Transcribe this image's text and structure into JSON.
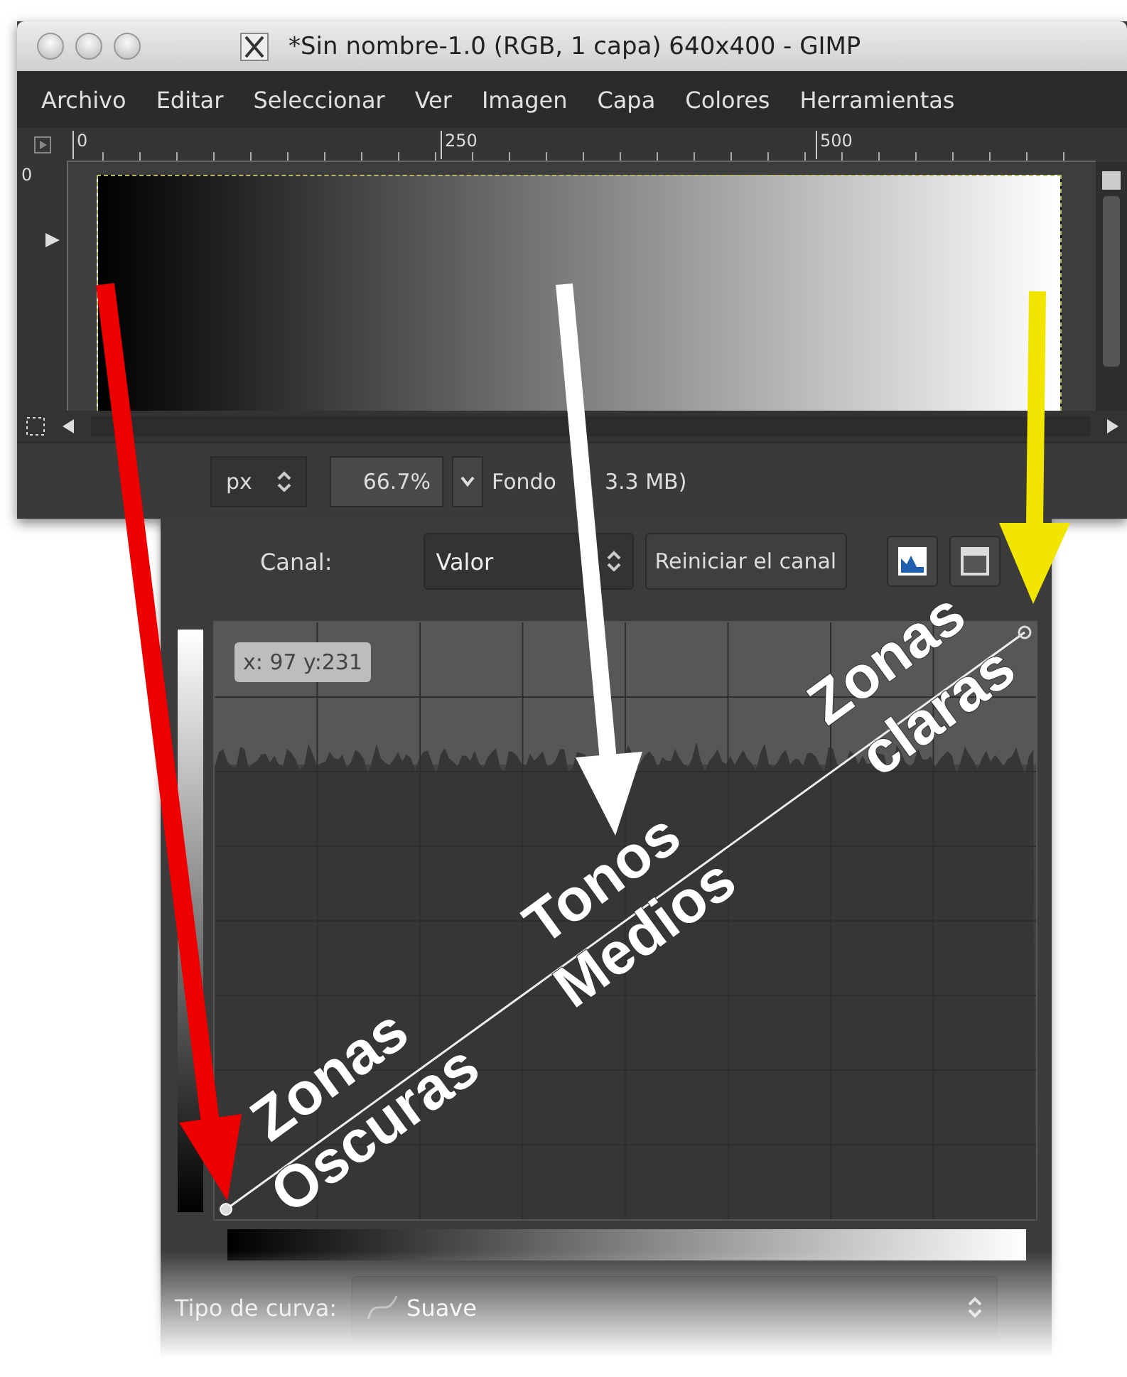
{
  "window": {
    "title": "*Sin nombre-1.0 (RGB, 1 capa) 640x400 - GIMP"
  },
  "menu": [
    "Archivo",
    "Editar",
    "Seleccionar",
    "Ver",
    "Imagen",
    "Capa",
    "Colores",
    "Herramientas"
  ],
  "ruler": {
    "horizontal": [
      "0",
      "250",
      "500"
    ],
    "vertical": [
      "0"
    ]
  },
  "status_bar": {
    "unit": "px",
    "zoom": "66.7%",
    "info": [
      "Fondo",
      "3.3 MB)"
    ]
  },
  "curves": {
    "channel_label": "Canal:",
    "channel": "Valor",
    "reset_button": "Reiniciar el canal",
    "tooltip": "x: 97 y:231",
    "curve_type_label": "Tipo de curva:",
    "curve_type": "Suave"
  },
  "annotations": [
    {
      "lines": [
        "Zonas",
        "Oscuras"
      ]
    },
    {
      "lines": [
        "Tonos",
        "Medios"
      ]
    },
    {
      "lines": [
        "Zonas",
        "claras"
      ]
    }
  ]
}
